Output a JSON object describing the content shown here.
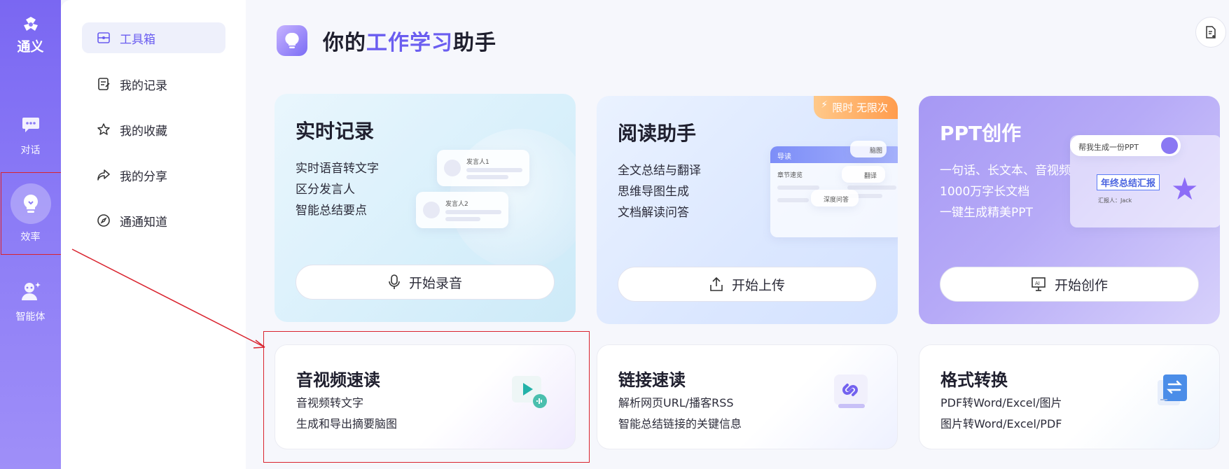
{
  "rail": {
    "logo_text": "通义",
    "items": [
      {
        "label": "对话",
        "icon": "chat-icon"
      },
      {
        "label": "效率",
        "icon": "bulb-icon"
      },
      {
        "label": "智能体",
        "icon": "agent-icon"
      }
    ]
  },
  "nav": {
    "items": [
      {
        "label": "工具箱",
        "icon": "toolbox-icon"
      },
      {
        "label": "我的记录",
        "icon": "record-icon"
      },
      {
        "label": "我的收藏",
        "icon": "star-icon"
      },
      {
        "label": "我的分享",
        "icon": "share-icon"
      },
      {
        "label": "通通知道",
        "icon": "compass-icon"
      }
    ]
  },
  "header": {
    "title_prefix": "你的",
    "title_accent": "工作学习",
    "title_suffix": "助手"
  },
  "cards": {
    "realtime": {
      "title": "实时记录",
      "lines": [
        "实时语音转文字",
        "区分发言人",
        "智能总结要点"
      ],
      "button": "开始录音",
      "mini_speaker1": "发言人1",
      "mini_speaker2": "发言人2"
    },
    "reading": {
      "title": "阅读助手",
      "lines": [
        "全文总结与翻译",
        "思维导图生成",
        "文档解读问答"
      ],
      "button": "开始上传",
      "badge": "限时 无限次",
      "mini_guide": "导读",
      "mini_mindmap": "脑图",
      "mini_chapter": "章节速览",
      "mini_translate": "翻译",
      "mini_qa": "深度问答"
    },
    "ppt": {
      "title": "PPT创作",
      "lines": [
        "一句话、长文本、音视频",
        "1000万字长文档",
        "一键生成精美PPT"
      ],
      "button": "开始创作",
      "mini_prompt": "帮我生成一份PPT",
      "mini_heading": "年终总结汇报",
      "mini_reporter": "汇报人：Jack"
    },
    "av": {
      "title": "音视频速读",
      "lines": [
        "音视频转文字",
        "生成和导出摘要脑图"
      ]
    },
    "link": {
      "title": "链接速读",
      "lines": [
        "解析网页URL/播客RSS",
        "智能总结链接的关键信息"
      ]
    },
    "convert": {
      "title": "格式转换",
      "lines": [
        "PDF转Word/Excel/图片",
        "图片转Word/Excel/PDF"
      ]
    }
  },
  "colors": {
    "accent": "#6a5df0",
    "rail": "#7a67f2",
    "highlight": "#d9232e",
    "badge": "#ff9c4d"
  }
}
